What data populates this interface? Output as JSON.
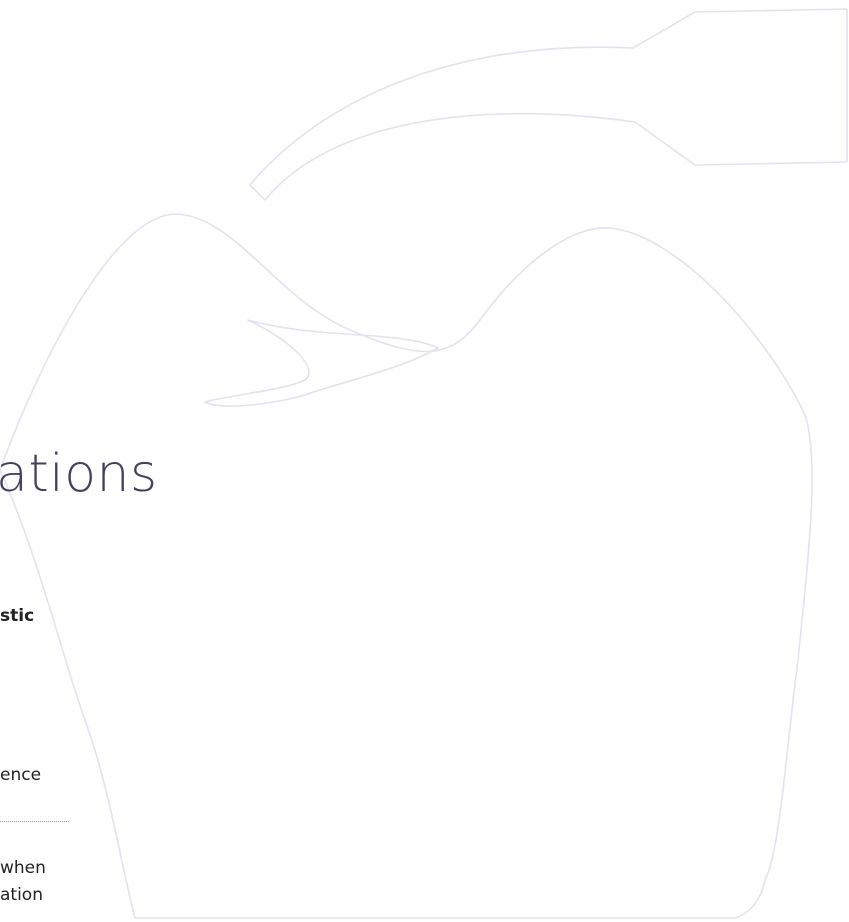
{
  "section": {
    "heading": "ations",
    "subtitle": "stic",
    "text_line_1": "ence",
    "text_line_2": "when",
    "text_line_3": "ation"
  },
  "colors": {
    "heading": "#46405f",
    "body_text": "#222222",
    "illustration_stroke": "#e3e2ef"
  },
  "icons": {
    "illustration": "apple-outline-illustration"
  }
}
